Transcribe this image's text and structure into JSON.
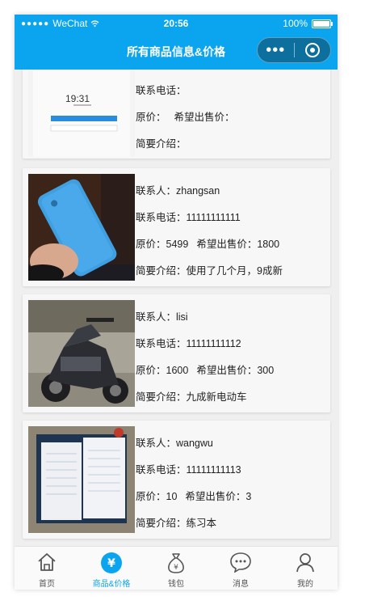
{
  "status_bar": {
    "carrier": "WeChat",
    "time": "20:56",
    "battery": "100%"
  },
  "navbar": {
    "title": "所有商品信息&价格"
  },
  "first_card": {
    "phone_label": "联系电话：",
    "price_label": "原价：",
    "want_label": "希望出售价：",
    "desc_label": "简要介绍：",
    "screen_time": "19:31"
  },
  "listings": [
    {
      "contact": "联系人：zhangsan",
      "phone": "联系电话：11111111111",
      "price": "原价：5499",
      "want": "希望出售价：1800",
      "desc": "简要介绍：使用了几个月，9成新",
      "image": "blue-phone-photo"
    },
    {
      "contact": "联系人：lisi",
      "phone": "联系电话：11111111112",
      "price": "原价：1600",
      "want": "希望出售价：300",
      "desc": "简要介绍：九成新电动车",
      "image": "scooter-photo"
    },
    {
      "contact": "联系人：wangwu",
      "phone": "联系电话：11111111113",
      "price": "原价：10",
      "want": "希望出售价：3",
      "desc": "简要介绍：练习本",
      "image": "notebook-photo"
    }
  ],
  "tabbar": {
    "items": [
      {
        "label": "首页",
        "icon": "home-icon"
      },
      {
        "label": "商品&价格",
        "icon": "yen-icon"
      },
      {
        "label": "钱包",
        "icon": "money-bag-icon"
      },
      {
        "label": "消息",
        "icon": "chat-bubble-icon"
      },
      {
        "label": "我的",
        "icon": "user-icon"
      }
    ],
    "active": "商品&价格",
    "active_color": "#0aa5ee"
  },
  "colors": {
    "accent": "#0aa5ee",
    "card": "#f7f7f7"
  }
}
